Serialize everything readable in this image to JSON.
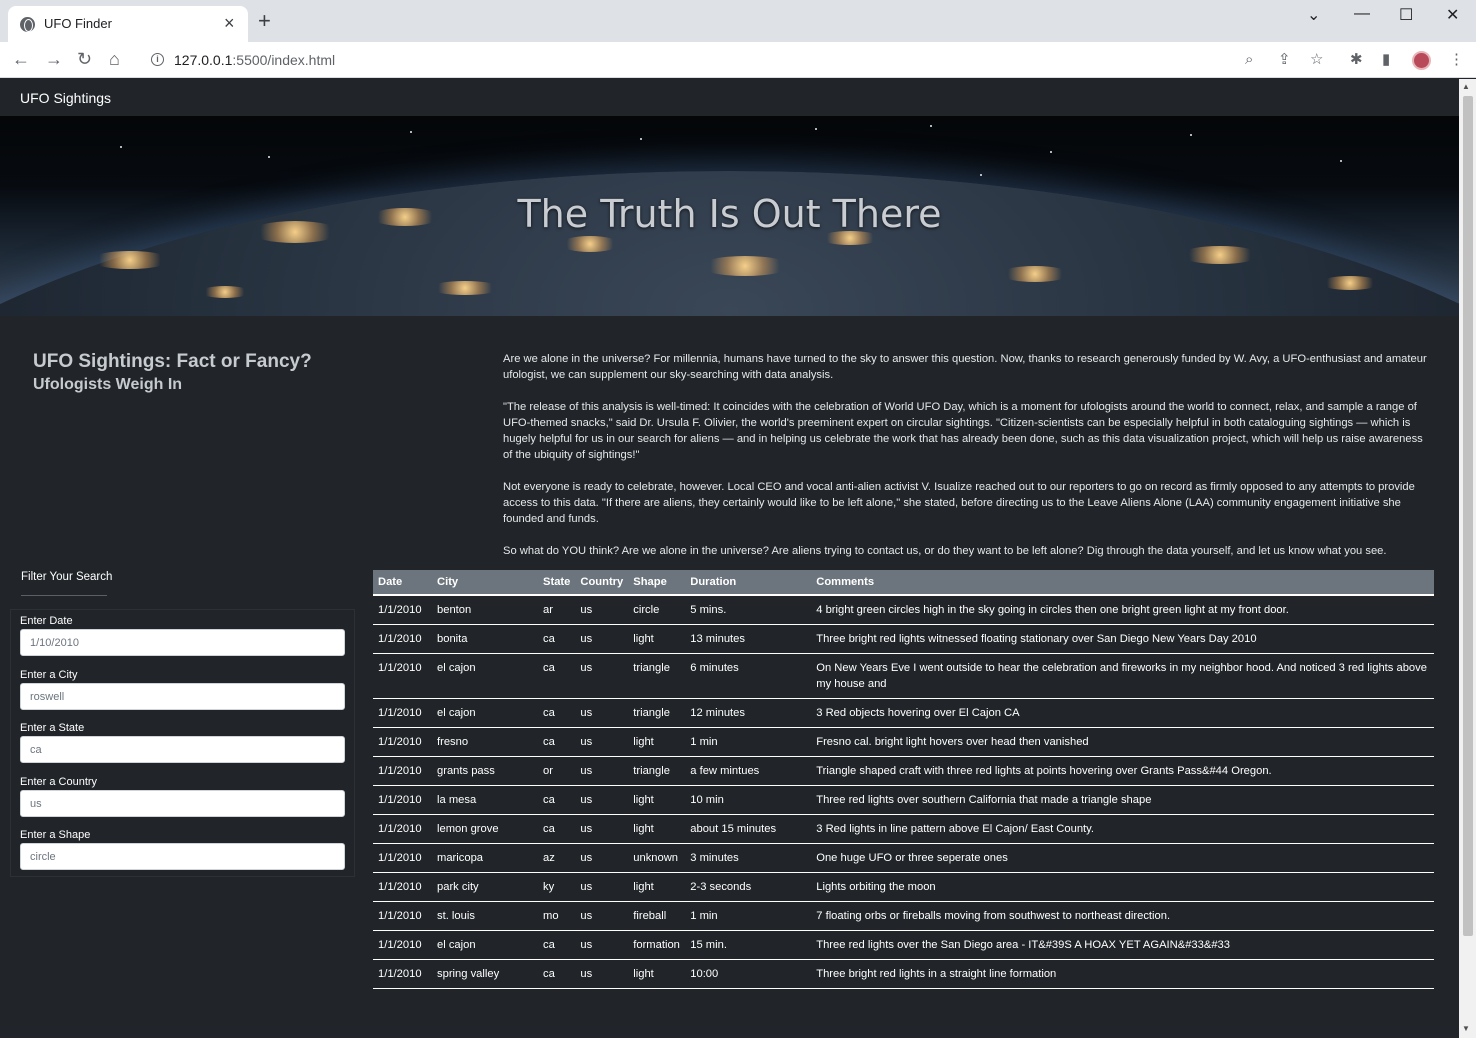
{
  "browser": {
    "tab_title": "UFO Finder",
    "url_host": "127.0.0.1",
    "url_rest": ":5500/index.html"
  },
  "navbar": {
    "brand": "UFO Sightings"
  },
  "hero": {
    "title": "The Truth Is Out There"
  },
  "intro": {
    "heading": "UFO Sightings: Fact or Fancy?",
    "subheading": "Ufologists Weigh In",
    "paragraphs": [
      "Are we alone in the universe? For millennia, humans have turned to the sky to answer this question. Now, thanks to research generously funded by W. Avy, a UFO-enthusiast and amateur ufologist, we can supplement our sky-searching with data analysis.",
      "\"The release of this analysis is well-timed: It coincides with the celebration of World UFO Day, which is a moment for ufologists around the world to connect, relax, and sample a range of UFO-themed snacks,\" said Dr. Ursula F. Olivier, the world's preeminent expert on circular sightings. \"Citizen-scientists can be especially helpful in both cataloguing sightings — which is hugely helpful for us in our search for aliens — and in helping us celebrate the work that has already been done, such as this data visualization project, which will help us raise awareness of the ubiquity of sightings!\"",
      "Not everyone is ready to celebrate, however. Local CEO and vocal anti-alien activist V. Isualize reached out to our reporters to go on record as firmly opposed to any attempts to provide access to this data. \"If there are aliens, they certainly would like to be left alone,\" she stated, before directing us to the Leave Aliens Alone (LAA) community engagement initiative she founded and funds.",
      "So what do YOU think? Are we alone in the universe? Are aliens trying to contact us, or do they want to be left alone? Dig through the data yourself, and let us know what you see."
    ]
  },
  "filters": {
    "title": "Filter Your Search",
    "fields": [
      {
        "label": "Enter Date",
        "placeholder": "1/10/2010"
      },
      {
        "label": "Enter a City",
        "placeholder": "roswell"
      },
      {
        "label": "Enter a State",
        "placeholder": "ca"
      },
      {
        "label": "Enter a Country",
        "placeholder": "us"
      },
      {
        "label": "Enter a Shape",
        "placeholder": "circle"
      }
    ]
  },
  "table": {
    "headers": [
      "Date",
      "City",
      "State",
      "Country",
      "Shape",
      "Duration",
      "Comments"
    ],
    "rows": [
      [
        "1/1/2010",
        "benton",
        "ar",
        "us",
        "circle",
        "5 mins.",
        "4 bright green circles high in the sky going in circles then one bright green light at my front door."
      ],
      [
        "1/1/2010",
        "bonita",
        "ca",
        "us",
        "light",
        "13 minutes",
        "Three bright red lights witnessed floating stationary over San Diego New Years Day 2010"
      ],
      [
        "1/1/2010",
        "el cajon",
        "ca",
        "us",
        "triangle",
        "6 minutes",
        "On New Years Eve I went outside to hear the celebration and fireworks in my neighbor hood. And noticed 3 red lights above my house and"
      ],
      [
        "1/1/2010",
        "el cajon",
        "ca",
        "us",
        "triangle",
        "12 minutes",
        "3 Red objects hovering over El Cajon CA"
      ],
      [
        "1/1/2010",
        "fresno",
        "ca",
        "us",
        "light",
        "1 min",
        "Fresno cal. bright light hovers over head then vanished"
      ],
      [
        "1/1/2010",
        "grants pass",
        "or",
        "us",
        "triangle",
        "a few mintues",
        "Triangle shaped craft with three red lights at points hovering over Grants Pass&#44 Oregon."
      ],
      [
        "1/1/2010",
        "la mesa",
        "ca",
        "us",
        "light",
        "10 min",
        "Three red lights over southern California that made a triangle shape"
      ],
      [
        "1/1/2010",
        "lemon grove",
        "ca",
        "us",
        "light",
        "about 15 minutes",
        "3 Red lights in line pattern above El Cajon/ East County."
      ],
      [
        "1/1/2010",
        "maricopa",
        "az",
        "us",
        "unknown",
        "3 minutes",
        "One huge UFO or three seperate ones"
      ],
      [
        "1/1/2010",
        "park city",
        "ky",
        "us",
        "light",
        "2-3 seconds",
        "Lights orbiting the moon"
      ],
      [
        "1/1/2010",
        "st. louis",
        "mo",
        "us",
        "fireball",
        "1 min",
        "7 floating orbs or fireballs moving from southwest to northeast direction."
      ],
      [
        "1/1/2010",
        "el cajon",
        "ca",
        "us",
        "formation",
        "15 min.",
        "Three red lights over the San Diego area - IT&#39S A HOAX YET AGAIN&#33&#33"
      ],
      [
        "1/1/2010",
        "spring valley",
        "ca",
        "us",
        "light",
        "10:00",
        "Three bright red lights in a straight line formation"
      ]
    ]
  }
}
